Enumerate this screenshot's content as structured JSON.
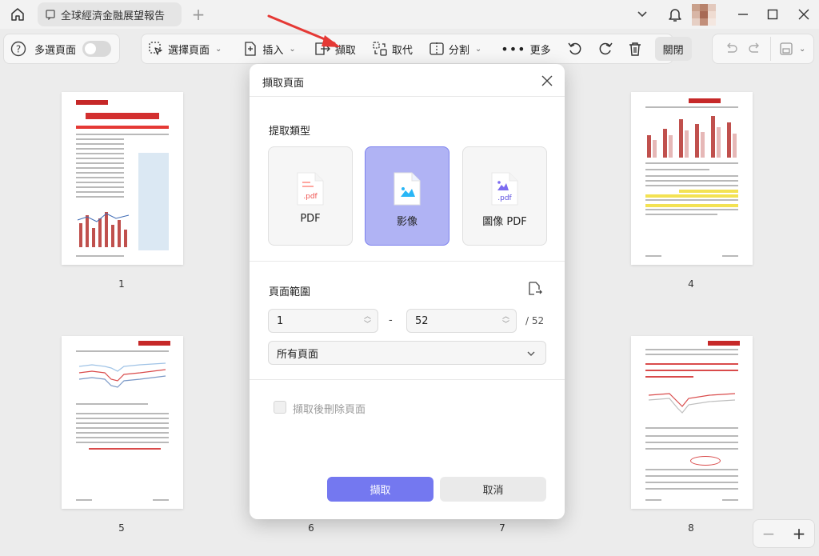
{
  "titlebar": {
    "tab_title": "全球經濟金融展望報告",
    "tab_add": "+"
  },
  "toolbar": {
    "help": "?",
    "multi_page_label": "多選頁面",
    "select_page_label": "選擇頁面",
    "insert_label": "插入",
    "extract_label": "擷取",
    "replace_label": "取代",
    "split_label": "分割",
    "more_label": "更多",
    "close_label": "關閉"
  },
  "pages": {
    "p1": "1",
    "p4": "4",
    "p5": "5",
    "p6": "6",
    "p7": "7",
    "p8": "8"
  },
  "dialog": {
    "title": "擷取頁面",
    "extract_type_label": "提取類型",
    "types": [
      {
        "label": "PDF",
        "selected": false
      },
      {
        "label": "影像",
        "selected": true
      },
      {
        "label": "圖像 PDF",
        "selected": false
      }
    ],
    "page_range_label": "頁面範圍",
    "range_from": "1",
    "range_dash": "-",
    "range_to": "52",
    "range_total": "/ 52",
    "page_subset": "所有頁面",
    "delete_after_label": "擷取後刪除頁面",
    "delete_after_checked": false,
    "extract_button": "擷取",
    "cancel_button": "取消"
  },
  "zoom": {
    "minus": "−",
    "plus": "+"
  },
  "colors": {
    "accent": "#7478f0",
    "selected_card": "#b0b3f4",
    "annotation_arrow": "#e53935"
  }
}
